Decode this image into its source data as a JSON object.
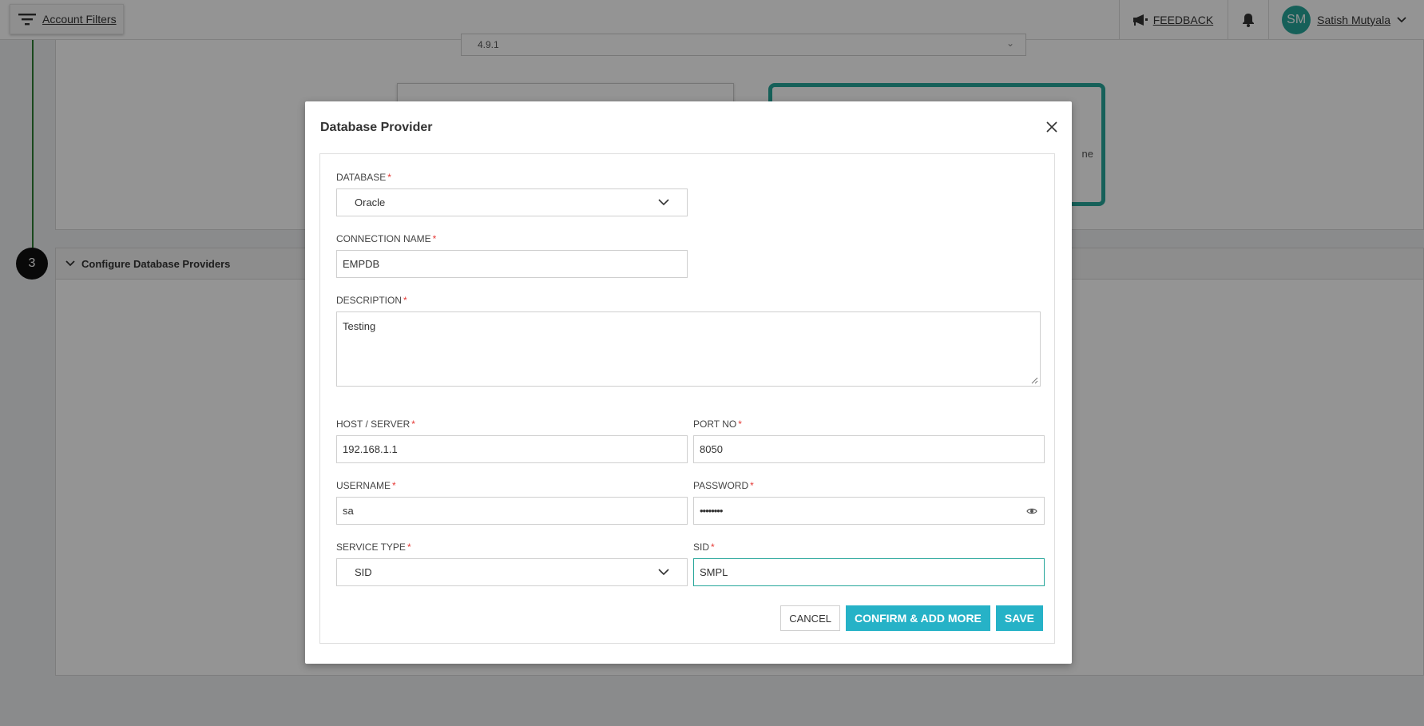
{
  "topbar": {
    "filters_label": "Account Filters",
    "feedback_label": "FEEDBACK",
    "user_initials": "SM",
    "user_name": "Satish Mutyala"
  },
  "background": {
    "version_value": "4.9.1",
    "selected_tile_text": "ne",
    "step_number": "3",
    "section_title": "Configure Database Providers"
  },
  "modal": {
    "title": "Database Provider",
    "fields": {
      "database": {
        "label": "DATABASE",
        "value": "Oracle"
      },
      "connection_name": {
        "label": "CONNECTION NAME",
        "value": "EMPDB"
      },
      "description": {
        "label": "DESCRIPTION",
        "value": "Testing"
      },
      "host": {
        "label": "HOST / SERVER",
        "value": "192.168.1.1"
      },
      "port": {
        "label": "PORT NO",
        "value": "8050"
      },
      "username": {
        "label": "USERNAME",
        "value": "sa"
      },
      "password": {
        "label": "PASSWORD",
        "value": "••••••••"
      },
      "service_type": {
        "label": "SERVICE TYPE",
        "value": "SID"
      },
      "sid": {
        "label": "SID",
        "value": "SMPL"
      }
    },
    "required_marker": "*",
    "buttons": {
      "cancel": "CANCEL",
      "confirm_add_more": "CONFIRM & ADD MORE",
      "save": "SAVE"
    }
  },
  "colors": {
    "accent": "#26b2c7",
    "teal": "#26a69a",
    "required": "#e53935"
  }
}
